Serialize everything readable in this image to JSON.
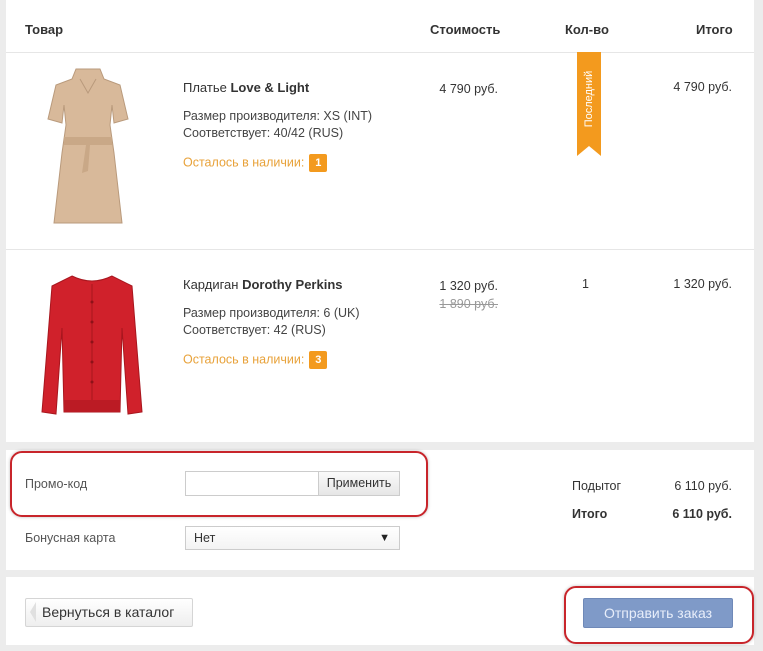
{
  "table": {
    "headers": {
      "product": "Товар",
      "cost": "Стоимость",
      "qty": "Кол-во",
      "total": "Итого"
    },
    "items": [
      {
        "name_prefix": "Платье",
        "brand": "Love & Light",
        "size_maker": "Размер производителя: XS (INT)",
        "size_match": "Соответствует: 40/42 (RUS)",
        "stock_label": "Осталось в наличии:",
        "stock_count": "1",
        "price": "4 790 руб.",
        "old_price": "",
        "qty_badge": "Последний",
        "total": "4 790 руб.",
        "image_color": "#d8b99a"
      },
      {
        "name_prefix": "Кардиган",
        "brand": "Dorothy Perkins",
        "size_maker": "Размер производителя: 6 (UK)",
        "size_match": "Соответствует: 42 (RUS)",
        "stock_label": "Осталось в наличии:",
        "stock_count": "3",
        "price": "1 320 руб.",
        "old_price": "1 890 руб.",
        "qty": "1",
        "total": "1 320 руб.",
        "image_color": "#d0212b"
      }
    ]
  },
  "promo": {
    "promo_label": "Промо-код",
    "promo_value": "",
    "apply_label": "Применить",
    "bonus_label": "Бонусная карта",
    "bonus_selected": "Нет"
  },
  "summary": {
    "subtotal_label": "Подытог",
    "subtotal_value": "6 110 руб.",
    "total_label": "Итого",
    "total_value": "6 110 руб."
  },
  "actions": {
    "back_label": "Вернуться в каталог",
    "submit_label": "Отправить заказ"
  },
  "colors": {
    "accent_orange": "#f39a1e",
    "highlight_red": "#c8252b",
    "submit_blue": "#7f9ac8"
  }
}
